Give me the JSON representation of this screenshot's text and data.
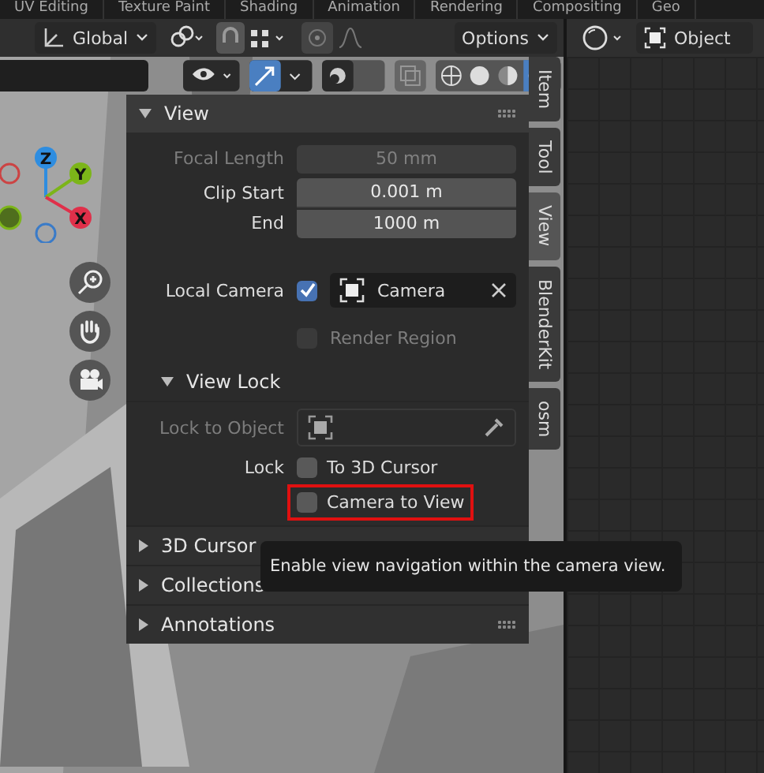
{
  "workspace_tabs": [
    "UV Editing",
    "Texture Paint",
    "Shading",
    "Animation",
    "Rendering",
    "Compositing",
    "Geo"
  ],
  "header": {
    "orientation": "Global",
    "options_label": "Options"
  },
  "right_header": {
    "mode": "Object"
  },
  "gizmo_axes": [
    {
      "label": "Z",
      "color": "#2e8de0"
    },
    {
      "label": "Y",
      "color": "#7cb519"
    },
    {
      "label": "X",
      "color": "#e0304a"
    }
  ],
  "sidebar_tabs": [
    {
      "label": "Item",
      "selected": false
    },
    {
      "label": "Tool",
      "selected": false
    },
    {
      "label": "View",
      "selected": true
    },
    {
      "label": "BlenderKit",
      "selected": false
    },
    {
      "label": "osm",
      "selected": false
    }
  ],
  "view_panel": {
    "title": "View",
    "expanded": true,
    "fields": [
      {
        "label": "Focal Length",
        "value": "50 mm",
        "disabled": true
      },
      {
        "label": "Clip Start",
        "value": "0.001 m",
        "disabled": false
      },
      {
        "label": "End",
        "value": "1000 m",
        "disabled": false
      }
    ],
    "local_camera": {
      "label": "Local Camera",
      "checked": true,
      "object": "Camera"
    },
    "render_region": {
      "label": "Render Region",
      "checked": false,
      "disabled": true
    }
  },
  "view_lock": {
    "title": "View Lock",
    "expanded": true,
    "lock_to_object": {
      "label": "Lock to Object",
      "disabled": true
    },
    "lock_label": "Lock",
    "options": [
      {
        "label": "To 3D Cursor",
        "checked": false,
        "highlighted": false
      },
      {
        "label": "Camera to View",
        "checked": false,
        "highlighted": true
      }
    ]
  },
  "collapsed_panels": [
    {
      "title": "3D Cursor",
      "expanded": false
    },
    {
      "title": "Collections",
      "expanded": false
    },
    {
      "title": "Annotations",
      "expanded": false
    }
  ],
  "tooltip": "Enable view navigation within the camera view."
}
